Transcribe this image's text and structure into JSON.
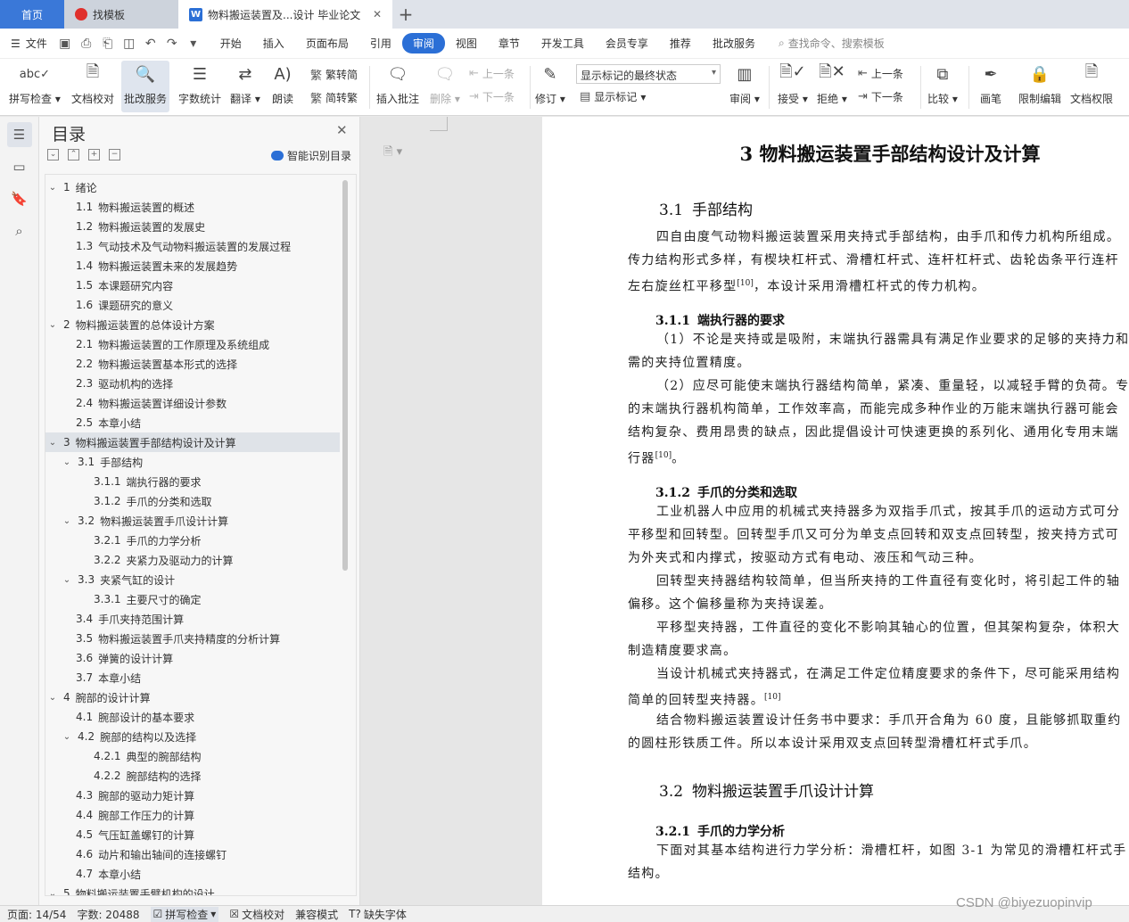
{
  "tabs": {
    "home": "首页",
    "template": "找模板",
    "document": "物料搬运装置及...设计 毕业论文"
  },
  "menu": {
    "file": "文件",
    "items": [
      "开始",
      "插入",
      "页面布局",
      "引用",
      "审阅",
      "视图",
      "章节",
      "开发工具",
      "会员专享",
      "推荐",
      "批改服务"
    ],
    "active": "审阅",
    "search": "查找命令、搜索模板"
  },
  "ribbon": {
    "spellcheck": "拼写检查",
    "doc_proof": "文档校对",
    "review_service": "批改服务",
    "word_count": "字数统计",
    "translate": "翻译",
    "read_aloud": "朗读",
    "to_traditional": "繁转简",
    "to_simplified": "简转繁",
    "insert_comment": "插入批注",
    "delete": "删除",
    "prev": "上一条",
    "next": "下一条",
    "track": "修订",
    "markup_mode": "显示标记的最终状态",
    "show_markup": "显示标记",
    "review": "审阅",
    "accept": "接受",
    "reject": "拒绝",
    "prev2": "上一条",
    "next2": "下一条",
    "compare": "比较",
    "pen": "画笔",
    "restrict": "限制编辑",
    "permission": "文档权限"
  },
  "toc": {
    "title": "目录",
    "ai_label": "智能识别目录",
    "items": [
      {
        "level": 1,
        "num": "1",
        "text": "绪论",
        "exp": true
      },
      {
        "level": 2,
        "num": "1.1",
        "text": "物料搬运装置的概述"
      },
      {
        "level": 2,
        "num": "1.2",
        "text": "物料搬运装置的发展史"
      },
      {
        "level": 2,
        "num": "1.3",
        "text": "气动技术及气动物料搬运装置的发展过程"
      },
      {
        "level": 2,
        "num": "1.4",
        "text": "物料搬运装置未来的发展趋势"
      },
      {
        "level": 2,
        "num": "1.5",
        "text": "本课题研究内容"
      },
      {
        "level": 2,
        "num": "1.6",
        "text": "课题研究的意义"
      },
      {
        "level": 1,
        "num": "2",
        "text": "物料搬运装置的总体设计方案",
        "exp": true
      },
      {
        "level": 2,
        "num": "2.1",
        "text": "物料搬运装置的工作原理及系统组成"
      },
      {
        "level": 2,
        "num": "2.2",
        "text": "物料搬运装置基本形式的选择"
      },
      {
        "level": 2,
        "num": "2.3",
        "text": "驱动机构的选择"
      },
      {
        "level": 2,
        "num": "2.4",
        "text": "物料搬运装置详细设计参数"
      },
      {
        "level": 2,
        "num": "2.5",
        "text": "本章小结"
      },
      {
        "level": 1,
        "num": "3",
        "text": "物料搬运装置手部结构设计及计算",
        "exp": true,
        "sel": true
      },
      {
        "level": 2,
        "num": "3.1",
        "text": "手部结构",
        "exp": true
      },
      {
        "level": 3,
        "num": "3.1.1",
        "text": "端执行器的要求"
      },
      {
        "level": 3,
        "num": "3.1.2",
        "text": "手爪的分类和选取"
      },
      {
        "level": 2,
        "num": "3.2",
        "text": "物料搬运装置手爪设计计算",
        "exp": true
      },
      {
        "level": 3,
        "num": "3.2.1",
        "text": "手爪的力学分析"
      },
      {
        "level": 3,
        "num": "3.2.2",
        "text": "夹紧力及驱动力的计算"
      },
      {
        "level": 2,
        "num": "3.3",
        "text": "夹紧气缸的设计",
        "exp": true
      },
      {
        "level": 3,
        "num": "3.3.1",
        "text": "主要尺寸的确定"
      },
      {
        "level": 2,
        "num": "3.4",
        "text": "手爪夹持范围计算"
      },
      {
        "level": 2,
        "num": "3.5",
        "text": "物料搬运装置手爪夹持精度的分析计算"
      },
      {
        "level": 2,
        "num": "3.6",
        "text": "弹簧的设计计算"
      },
      {
        "level": 2,
        "num": "3.7",
        "text": "本章小结"
      },
      {
        "level": 1,
        "num": "4",
        "text": "腕部的设计计算",
        "exp": true
      },
      {
        "level": 2,
        "num": "4.1",
        "text": "腕部设计的基本要求"
      },
      {
        "level": 2,
        "num": "4.2",
        "text": "腕部的结构以及选择",
        "exp": true
      },
      {
        "level": 3,
        "num": "4.2.1",
        "text": "典型的腕部结构"
      },
      {
        "level": 3,
        "num": "4.2.2",
        "text": "腕部结构的选择"
      },
      {
        "level": 2,
        "num": "4.3",
        "text": "腕部的驱动力矩计算"
      },
      {
        "level": 2,
        "num": "4.4",
        "text": "腕部工作压力的计算"
      },
      {
        "level": 2,
        "num": "4.5",
        "text": "气压缸盖螺钉的计算"
      },
      {
        "level": 2,
        "num": "4.6",
        "text": "动片和输出轴间的连接螺钉"
      },
      {
        "level": 2,
        "num": "4.7",
        "text": "本章小结"
      },
      {
        "level": 1,
        "num": "5",
        "text": "物料搬运装置手臂机构的设计",
        "exp": true
      }
    ]
  },
  "doc": {
    "chapter": "3  物料搬运装置手部结构设计及计算",
    "s31_num": "3.1",
    "s31": "手部结构",
    "p1": "四自由度气动物料搬运装置采用夹持式手部结构，由手爪和传力机构所组成。",
    "p1b": "传力结构形式多样，有楔块杠杆式、滑槽杠杆式、连杆杠杆式、齿轮齿条平行连杆",
    "p1c": "左右旋丝杠平移型",
    "p1c_ref": "[10]",
    "p1c_tail": "，本设计采用滑槽杠杆式的传力机构。",
    "s311_num": "3.1.1",
    "s311": "端执行器的要求",
    "p2": "（1）不论是夹持或是吸附，末端执行器需具有满足作业要求的足够的夹持力和",
    "p2b": "需的夹持位置精度。",
    "p3": "（2）应尽可能使末端执行器结构简单，紧凑、重量轻，以减轻手臂的负荷。专",
    "p3b": "的末端执行器机构简单，工作效率高，而能完成多种作业的万能末端执行器可能会",
    "p3c": "结构复杂、费用昂贵的缺点，因此提倡设计可快速更换的系列化、通用化专用末端",
    "p3d": "行器",
    "p3d_ref": "[10]",
    "p3d_tail": "。",
    "s312_num": "3.1.2",
    "s312": "手爪的分类和选取",
    "p4": "工业机器人中应用的机械式夹持器多为双指手爪式，按其手爪的运动方式可分",
    "p4b": "平移型和回转型。回转型手爪又可分为单支点回转和双支点回转型，按夹持方式可",
    "p4c": "为外夹式和内撑式，按驱动方式有电动、液压和气动三种。",
    "p5": "回转型夹持器结构较简单，但当所夹持的工件直径有变化时，将引起工件的轴",
    "p5b": "偏移。这个偏移量称为夹持误差。",
    "p6": "平移型夹持器，工件直径的变化不影响其轴心的位置，但其架构复杂，体积大",
    "p6b": "制造精度要求高。",
    "p7": "当设计机械式夹持器式，在满足工件定位精度要求的条件下，尽可能采用结构",
    "p7b": "简单的回转型夹持器。",
    "p7b_ref": "[10]",
    "p8": "结合物料搬运装置设计任务书中要求：手爪开合角为 60 度，且能够抓取重约",
    "p8b": "的圆柱形铁质工件。所以本设计采用双支点回转型滑槽杠杆式手爪。",
    "s32_num": "3.2",
    "s32": "物料搬运装置手爪设计计算",
    "s321_num": "3.2.1",
    "s321": "手爪的力学分析",
    "p9": "下面对其基本结构进行力学分析：滑槽杠杆，如图 3-1 为常见的滑槽杠杆式手",
    "p9b": "结构。"
  },
  "status": {
    "page": "页面: 14/54",
    "words": "字数: 20488",
    "spell": "拼写检查",
    "proof": "文档校对",
    "compat": "兼容模式",
    "font": "缺失字体"
  },
  "watermark": "CSDN @biyezuopinvip"
}
